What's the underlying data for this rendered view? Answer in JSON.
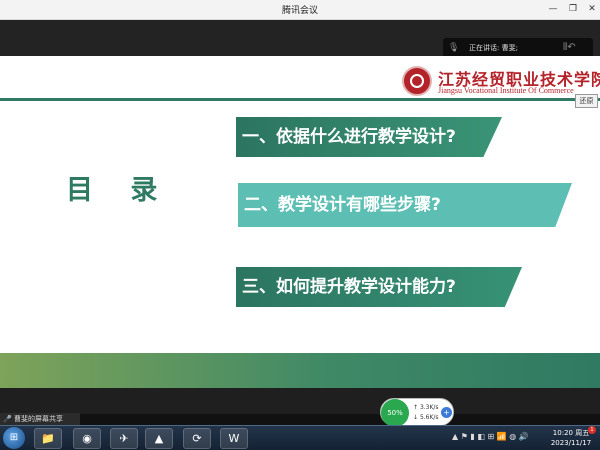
{
  "window": {
    "title": "腾讯会议",
    "min_glyph": "—",
    "max_glyph": "❐",
    "close_glyph": "✕"
  },
  "meeting": {
    "speaking_label": "正在讲话: 曹斐;",
    "restore_label": "还原",
    "share_label": "曹斐的屏幕共享"
  },
  "slide": {
    "school_cn": "江苏经贸职业技术学院",
    "school_en": "Jiangsu Vocational Institute Of Commerce",
    "toc_title": "目 录",
    "items": [
      {
        "label": "一、依据什么进行教学设计?"
      },
      {
        "label": "二、教学设计有哪些步骤?"
      },
      {
        "label": "三、如何提升教学设计能力?"
      }
    ],
    "colors": {
      "accent": "#2f7a62",
      "accent_light": "#5dbfb3",
      "brand_red": "#b4232a"
    }
  },
  "network": {
    "percent": "50%",
    "up_speed": "3.3K/s",
    "down_speed": "5.6K/s"
  },
  "taskbar": {
    "apps": [
      {
        "icon": "folder-icon",
        "glyph": "📁"
      },
      {
        "icon": "chrome-icon",
        "glyph": "◉"
      },
      {
        "icon": "bird-icon",
        "glyph": "✈"
      },
      {
        "icon": "tencent-meeting-icon",
        "glyph": "▲"
      },
      {
        "icon": "refresh-icon",
        "glyph": "⟳"
      },
      {
        "icon": "wps-icon",
        "glyph": "W"
      }
    ],
    "tray_text": "▲ ⚑ ▮ ◧ ⊞ 📶 ◍ 🔊",
    "time": "10:20 周五",
    "date": "2023/11/17",
    "badge": "1"
  }
}
